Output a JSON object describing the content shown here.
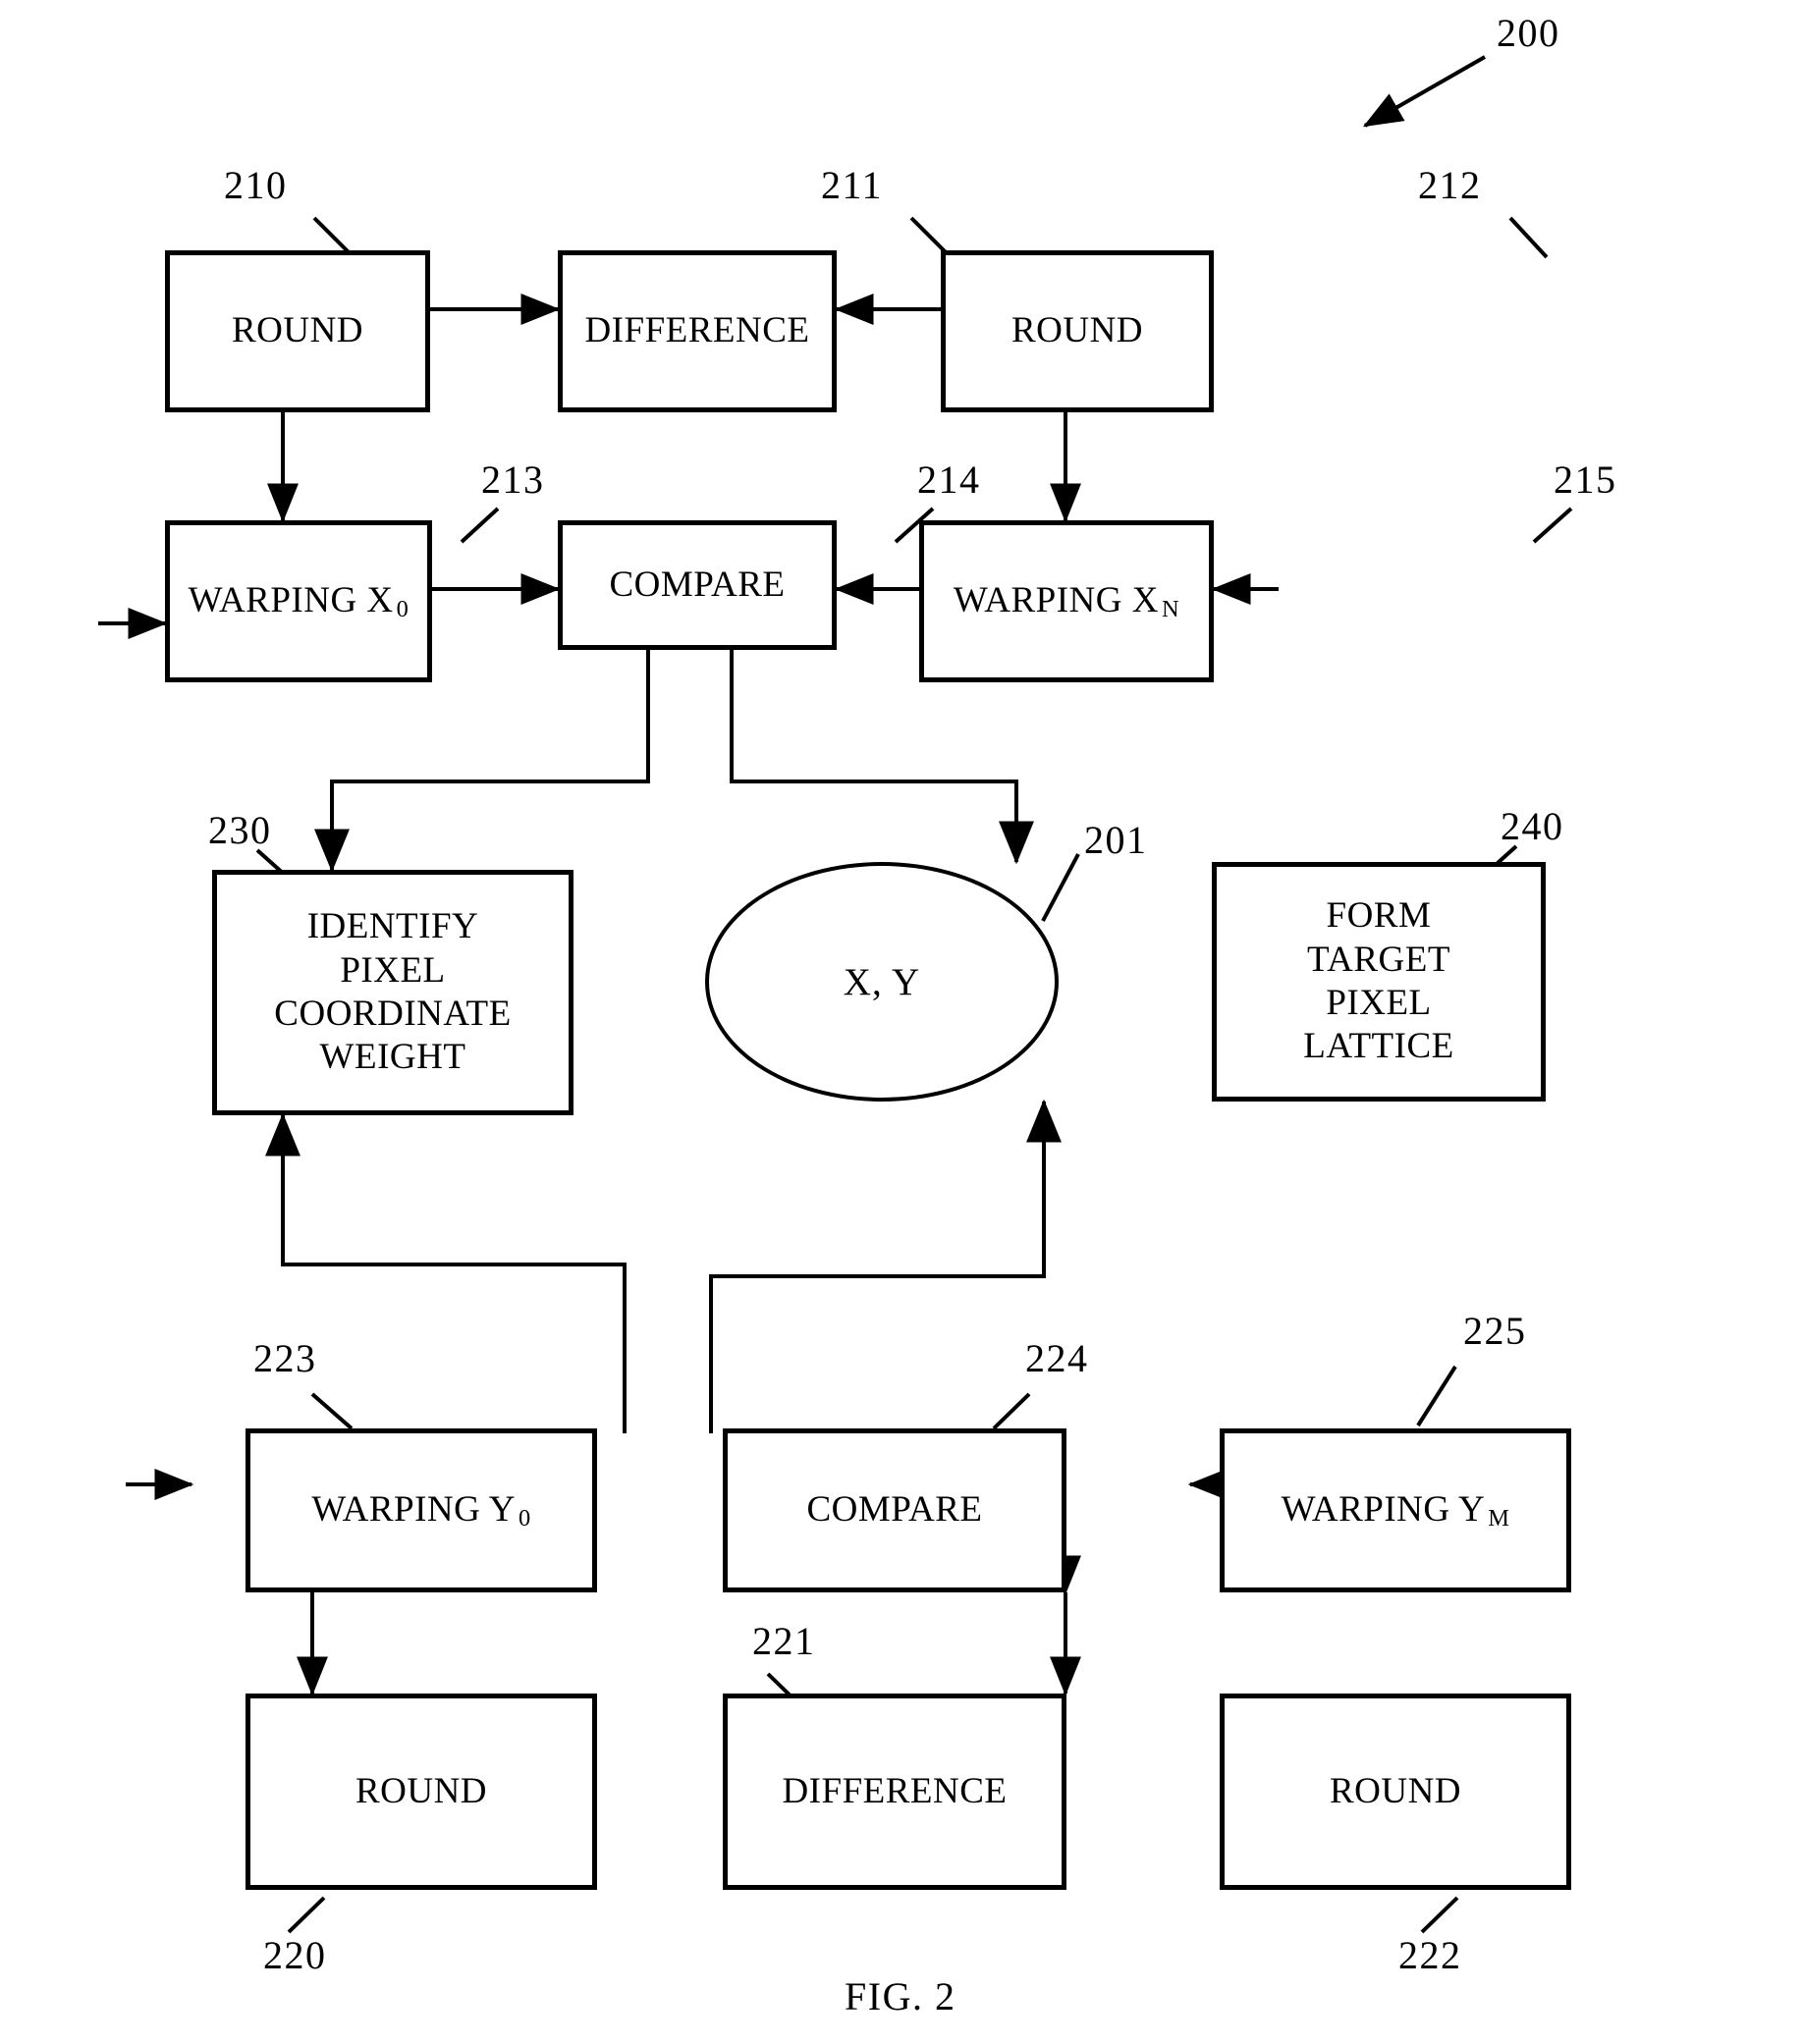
{
  "figure": {
    "caption": "FIG. 2",
    "top_reference": "200"
  },
  "boxes": {
    "round_210": {
      "label": "ROUND",
      "ref": "210"
    },
    "difference_211": {
      "label": "DIFFERENCE",
      "ref": "211"
    },
    "round_212": {
      "label": "ROUND",
      "ref": "212"
    },
    "warping_x0_213": {
      "label": "WARPING X",
      "sub": "0",
      "ref": "213"
    },
    "compare_214": {
      "label": "COMPARE",
      "ref": "214"
    },
    "warping_xn_215": {
      "label": "WARPING X",
      "sub": "N",
      "ref": "215"
    },
    "identify_230": {
      "label": "IDENTIFY\nPIXEL\nCOORDINATE\nWEIGHT",
      "ref": "230"
    },
    "xy_201": {
      "label": "X, Y",
      "ref": "201"
    },
    "form_240": {
      "label": "FORM\nTARGET\nPIXEL\nLATTICE",
      "ref": "240"
    },
    "warping_y0_223": {
      "label": "WARPING Y",
      "sub": "0",
      "ref": "223"
    },
    "compare_224": {
      "label": "COMPARE",
      "ref": "224"
    },
    "warping_ym_225": {
      "label": "WARPING Y",
      "sub": "M",
      "ref": "225"
    },
    "round_220": {
      "label": "ROUND",
      "ref": "220"
    },
    "difference_221": {
      "label": "DIFFERENCE",
      "ref": "221"
    },
    "round_222": {
      "label": "ROUND",
      "ref": "222"
    }
  },
  "colors": {
    "ink": "#000000",
    "paper": "#ffffff"
  }
}
